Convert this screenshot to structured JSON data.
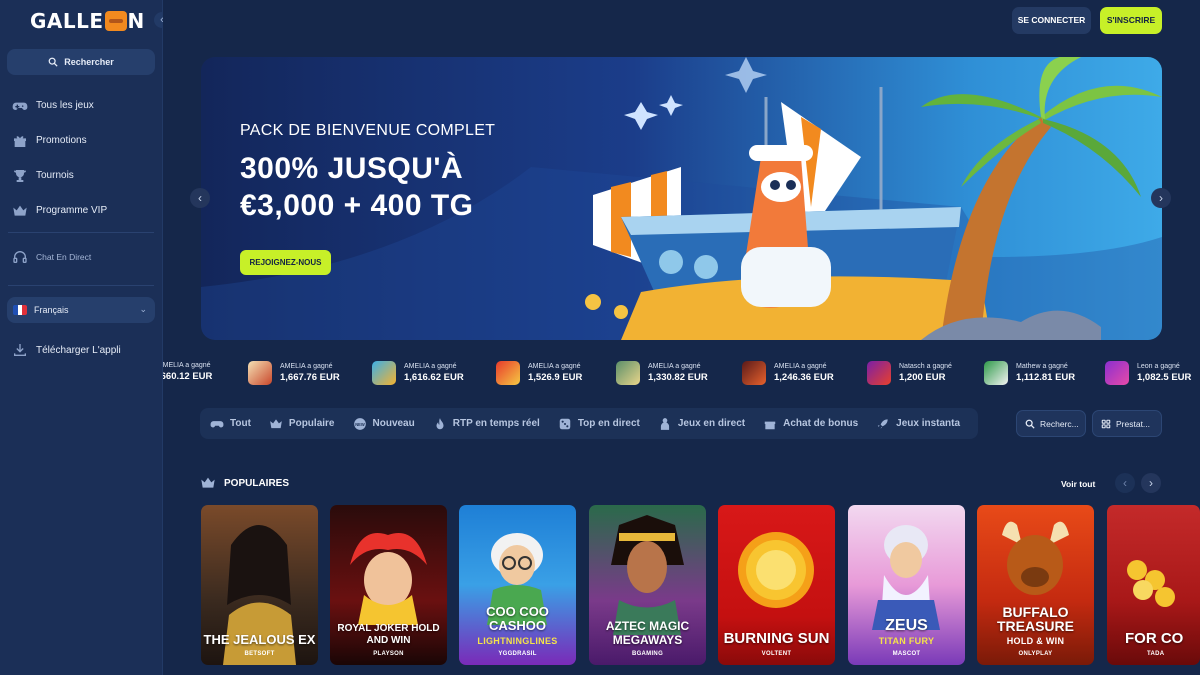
{
  "brand": {
    "name_left": "GALLE",
    "name_right": "N"
  },
  "sidebar": {
    "search_label": "Rechercher",
    "items": [
      {
        "label": "Tous les jeux",
        "icon": "gamepad-icon"
      },
      {
        "label": "Promotions",
        "icon": "gift-icon"
      },
      {
        "label": "Tournois",
        "icon": "trophy-icon"
      },
      {
        "label": "Programme VIP",
        "icon": "crown-icon"
      }
    ],
    "chat_label": "Chat En Direct",
    "language": "Français",
    "download_label": "Télécharger L'appli"
  },
  "header": {
    "login_label": "SE CONNECTER",
    "signup_label": "S'INSCRIRE"
  },
  "banner": {
    "eyebrow": "PACK DE BIENVENUE COMPLET",
    "headline_line1": "300% JUSQU'À",
    "headline_line2": "€3,000 + 400 TG",
    "cta_label": "REJOIGNEZ-NOUS"
  },
  "winners": [
    {
      "who": "AMELIA a gagné",
      "amount": ",660.12 EUR"
    },
    {
      "who": "AMELIA a gagné",
      "amount": "1,667.76 EUR"
    },
    {
      "who": "AMELIA a gagné",
      "amount": "1,616.62 EUR"
    },
    {
      "who": "AMELIA a gagné",
      "amount": "1,526.9 EUR"
    },
    {
      "who": "AMELIA a gagné",
      "amount": "1,330.82 EUR"
    },
    {
      "who": "AMELIA a gagné",
      "amount": "1,246.36 EUR"
    },
    {
      "who": "Natasch a gagné",
      "amount": "1,200 EUR"
    },
    {
      "who": "Mathew a gagné",
      "amount": "1,112.81 EUR"
    },
    {
      "who": "Leon a gagné",
      "amount": "1,082.5 EUR"
    }
  ],
  "categories": [
    {
      "label": "Tout",
      "icon": "gamepad-icon"
    },
    {
      "label": "Populaire",
      "icon": "crown-icon"
    },
    {
      "label": "Nouveau",
      "icon": "new-badge-icon"
    },
    {
      "label": "RTP en temps réel",
      "icon": "flame-icon"
    },
    {
      "label": "Top en direct",
      "icon": "dice-icon"
    },
    {
      "label": "Jeux en direct",
      "icon": "dealer-icon"
    },
    {
      "label": "Achat de bonus",
      "icon": "gift-icon"
    },
    {
      "label": "Jeux instanta",
      "icon": "rocket-icon"
    }
  ],
  "filters": {
    "search_label": "Recherc...",
    "provider_label": "Prestat..."
  },
  "popular": {
    "title": "POPULAIRES",
    "see_all": "Voir tout",
    "games": [
      {
        "title": "THE JEALOUS EX",
        "provider": "BETSOFT"
      },
      {
        "title": "ROYAL JOKER HOLD AND WIN",
        "provider": "PLAYSON"
      },
      {
        "title": "COO COO CASHOO",
        "subtitle": "LIGHTNINGLINES",
        "provider": "YGGDRASIL"
      },
      {
        "title": "AZTEC MAGIC MEGAWAYS",
        "provider": "BGAMING"
      },
      {
        "title": "BURNING SUN",
        "provider": "VOLTENT"
      },
      {
        "title": "ZEUS",
        "subtitle": "TITAN FURY",
        "provider": "MASCOT"
      },
      {
        "title": "BUFFALO TREASURE",
        "subtitle": "HOLD & WIN",
        "provider": "ONLYPLAY"
      },
      {
        "title": "FOR CO",
        "provider": "TADA"
      }
    ]
  }
}
